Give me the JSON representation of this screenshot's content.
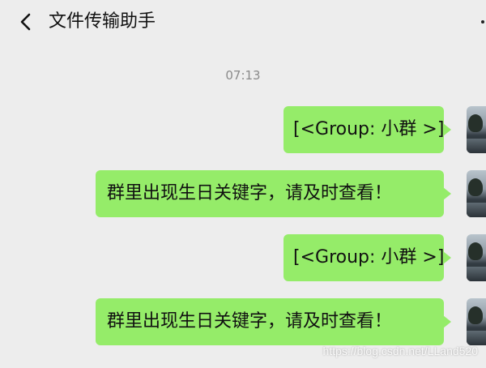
{
  "header": {
    "title": "文件传输助手",
    "back_icon": "chevron-left-icon",
    "more_icon": "more-icon"
  },
  "chat": {
    "timestamp": "07:13",
    "messages": [
      {
        "text": "[<Group: 小群 >]",
        "sender": "self"
      },
      {
        "text": "群里出现生日关键字，请及时查看！",
        "sender": "self"
      },
      {
        "text": "[<Group: 小群 >]",
        "sender": "self"
      },
      {
        "text": "群里出现生日关键字，请及时查看！",
        "sender": "self"
      }
    ]
  },
  "watermark": "https://blog.csdn.net/LLand520",
  "colors": {
    "background": "#ededed",
    "bubble": "#95ec69",
    "text": "#111111",
    "timestamp": "#8a8a8a"
  }
}
